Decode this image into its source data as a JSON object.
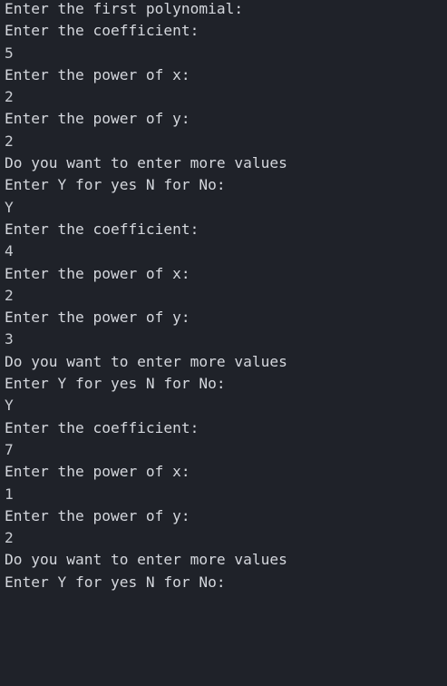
{
  "terminal": {
    "lines": [
      {
        "text": "Enter the first polynomial:",
        "kind": "prompt"
      },
      {
        "text": "Enter the coefficient:",
        "kind": "prompt"
      },
      {
        "text": "5",
        "kind": "input"
      },
      {
        "text": "Enter the power of x:",
        "kind": "prompt"
      },
      {
        "text": "2",
        "kind": "input"
      },
      {
        "text": "Enter the power of y:",
        "kind": "prompt"
      },
      {
        "text": "2",
        "kind": "input"
      },
      {
        "text": "Do you want to enter more values",
        "kind": "prompt"
      },
      {
        "text": "Enter Y for yes N for No:",
        "kind": "prompt"
      },
      {
        "text": "Y",
        "kind": "input"
      },
      {
        "text": "Enter the coefficient:",
        "kind": "prompt"
      },
      {
        "text": "4",
        "kind": "input"
      },
      {
        "text": "Enter the power of x:",
        "kind": "prompt"
      },
      {
        "text": "2",
        "kind": "input"
      },
      {
        "text": "Enter the power of y:",
        "kind": "prompt"
      },
      {
        "text": "3",
        "kind": "input"
      },
      {
        "text": "Do you want to enter more values",
        "kind": "prompt"
      },
      {
        "text": "Enter Y for yes N for No:",
        "kind": "prompt"
      },
      {
        "text": "Y",
        "kind": "input"
      },
      {
        "text": "Enter the coefficient:",
        "kind": "prompt"
      },
      {
        "text": "7",
        "kind": "input"
      },
      {
        "text": "Enter the power of x:",
        "kind": "prompt"
      },
      {
        "text": "1",
        "kind": "input"
      },
      {
        "text": "Enter the power of y:",
        "kind": "prompt"
      },
      {
        "text": "2",
        "kind": "input"
      },
      {
        "text": "Do you want to enter more values",
        "kind": "prompt"
      },
      {
        "text": "Enter Y for yes N for No:",
        "kind": "prompt"
      }
    ]
  },
  "colors": {
    "background": "#1f2229",
    "text": "#d4d7dd"
  }
}
